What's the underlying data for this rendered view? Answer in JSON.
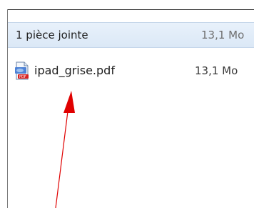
{
  "attachments": {
    "header": {
      "count_label": "1 pièce jointe",
      "total_size": "13,1 Mo"
    },
    "files": [
      {
        "name": "ipad_grise.pdf",
        "size": "13,1 Mo",
        "icon": "pdf-file-icon"
      }
    ]
  },
  "colors": {
    "header_background": "#dfeaf7",
    "annotation_arrow": "#e00000"
  }
}
